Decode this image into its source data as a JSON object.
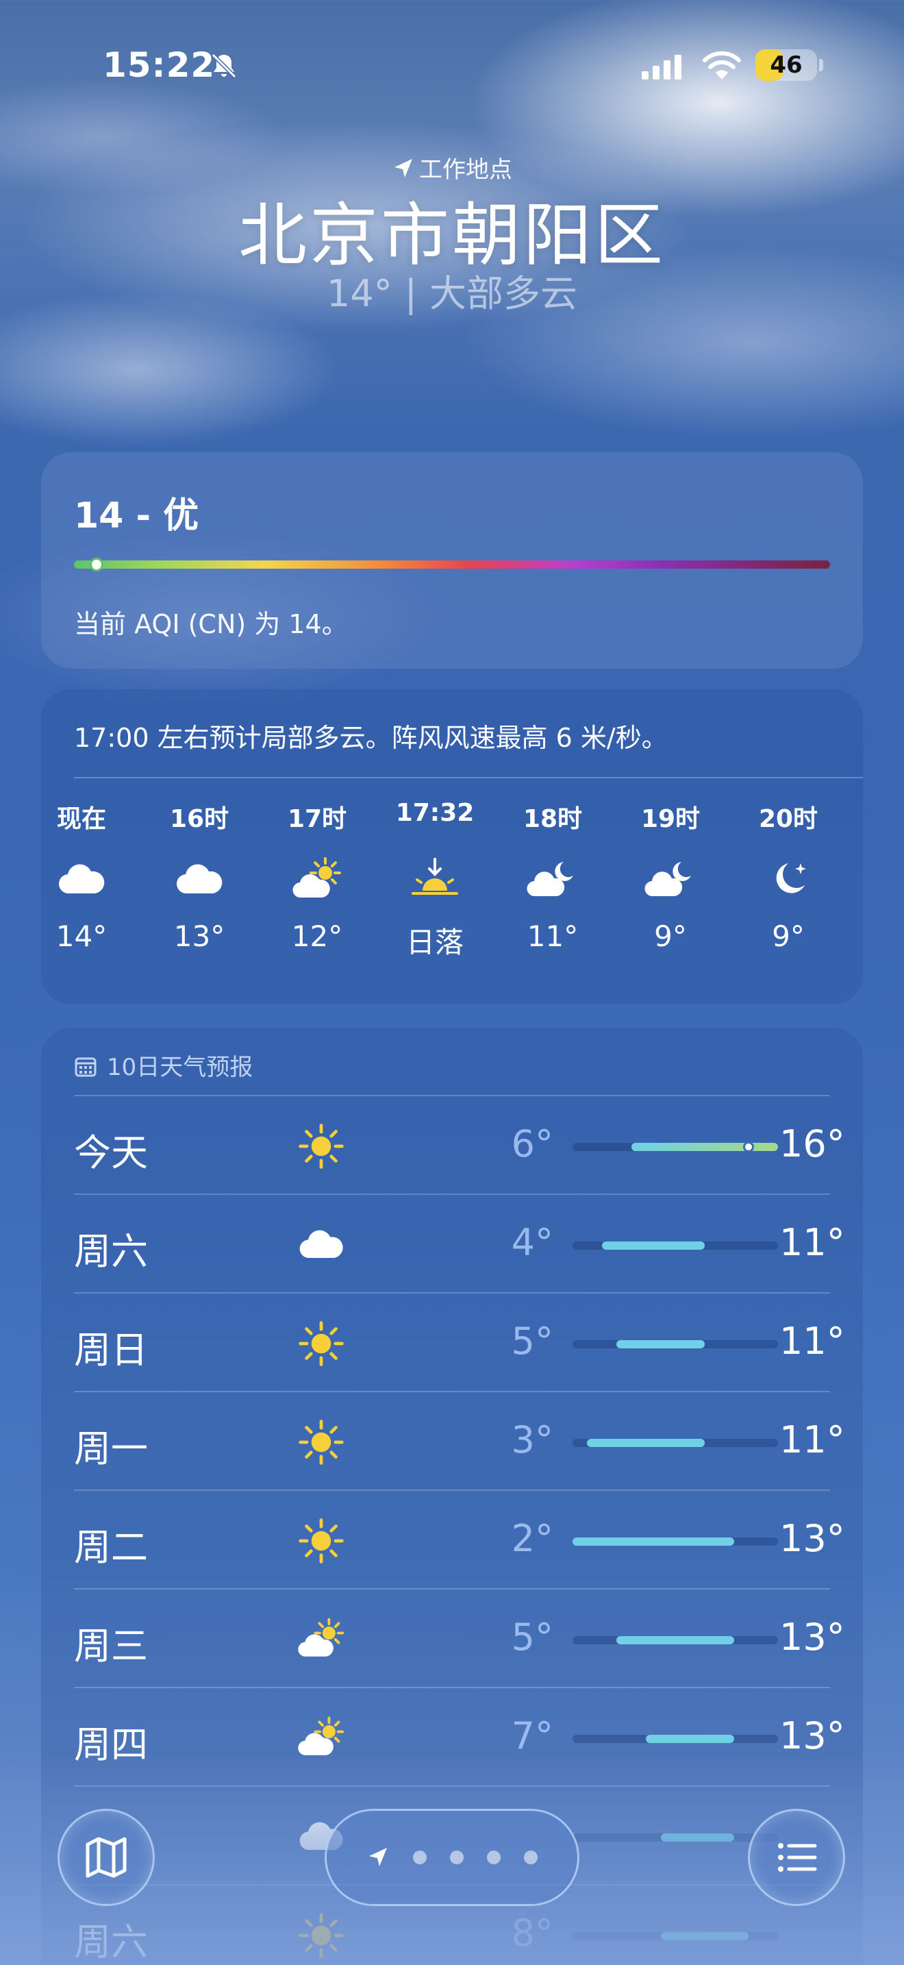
{
  "status_bar": {
    "time": "15:22",
    "battery": "46",
    "battery_level": 0.46,
    "icons": [
      "bell-slash-icon",
      "cellular-signal-icon",
      "wifi-icon",
      "battery-icon"
    ]
  },
  "header": {
    "location_tag": "工作地点",
    "city": "北京市朝阳区",
    "current_temp": "14°",
    "separator": "|",
    "condition": "大部多云"
  },
  "aqi": {
    "title": "14 - 优",
    "description": "当前 AQI (CN) 为 14。",
    "level": 0.03,
    "gradient_colors": [
      "#5ec46a",
      "#f2d64b",
      "#f39a3c",
      "#e8454c",
      "#b83fcf",
      "#7a2140"
    ]
  },
  "hourly": {
    "summary": "17:00 左右预计局部多云。阵风风速最高 6 米/秒。",
    "items": [
      {
        "label": "现在",
        "icon": "cloud-icon",
        "value": "14°"
      },
      {
        "label": "16时",
        "icon": "cloud-icon",
        "value": "13°"
      },
      {
        "label": "17时",
        "icon": "partly-sunny-icon",
        "value": "12°"
      },
      {
        "label": "17:32",
        "icon": "sunset-icon",
        "value": "日落"
      },
      {
        "label": "18时",
        "icon": "partly-cloudy-night-icon",
        "value": "11°"
      },
      {
        "label": "19时",
        "icon": "partly-cloudy-night-icon",
        "value": "9°"
      },
      {
        "label": "20时",
        "icon": "clear-night-icon",
        "value": "9°"
      }
    ]
  },
  "daily": {
    "header": "10日天气预报",
    "week_min": 2,
    "week_max": 16,
    "current_temp": 14,
    "days": [
      {
        "name": "今天",
        "icon": "sun-icon",
        "low": "6°",
        "high": "16°",
        "low_v": 6,
        "high_v": 16
      },
      {
        "name": "周六",
        "icon": "cloud-icon",
        "low": "4°",
        "high": "11°",
        "low_v": 4,
        "high_v": 11
      },
      {
        "name": "周日",
        "icon": "sun-icon",
        "low": "5°",
        "high": "11°",
        "low_v": 5,
        "high_v": 11
      },
      {
        "name": "周一",
        "icon": "sun-icon",
        "low": "3°",
        "high": "11°",
        "low_v": 3,
        "high_v": 11
      },
      {
        "name": "周二",
        "icon": "sun-icon",
        "low": "2°",
        "high": "13°",
        "low_v": 2,
        "high_v": 13
      },
      {
        "name": "周三",
        "icon": "partly-sunny-icon",
        "low": "5°",
        "high": "13°",
        "low_v": 5,
        "high_v": 13
      },
      {
        "name": "周四",
        "icon": "partly-sunny-icon",
        "low": "7°",
        "high": "13°",
        "low_v": 7,
        "high_v": 13
      },
      {
        "name": "",
        "icon": "cloud-icon",
        "low": "",
        "high": "",
        "low_v": 8,
        "high_v": 13
      },
      {
        "name": "周六",
        "icon": "sun-icon",
        "low": "8°",
        "high": "",
        "low_v": 8,
        "high_v": 14
      }
    ]
  },
  "bottom_nav": {
    "map_icon": "map-icon",
    "list_icon": "list-icon",
    "pages": 4,
    "current_page": 0
  }
}
